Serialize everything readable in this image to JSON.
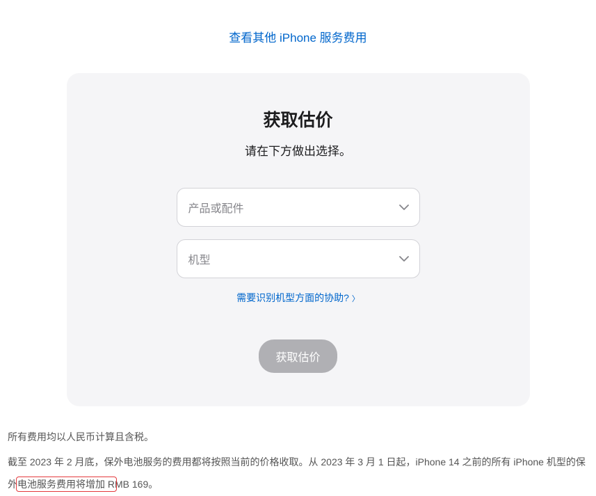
{
  "topLink": "查看其他 iPhone 服务费用",
  "card": {
    "title": "获取估价",
    "subtitle": "请在下方做出选择。",
    "productSelect": "产品或配件",
    "modelSelect": "机型",
    "helpLink": "需要识别机型方面的协助?",
    "submitButton": "获取估价"
  },
  "footer": {
    "line1": "所有费用均以人民币计算且含税。",
    "line2": "截至 2023 年 2 月底，保外电池服务的费用都将按照当前的价格收取。从 2023 年 3 月 1 日起，iPhone 14 之前的所有 iPhone 机型的保外电池服务费用将增加 RMB 169。"
  }
}
